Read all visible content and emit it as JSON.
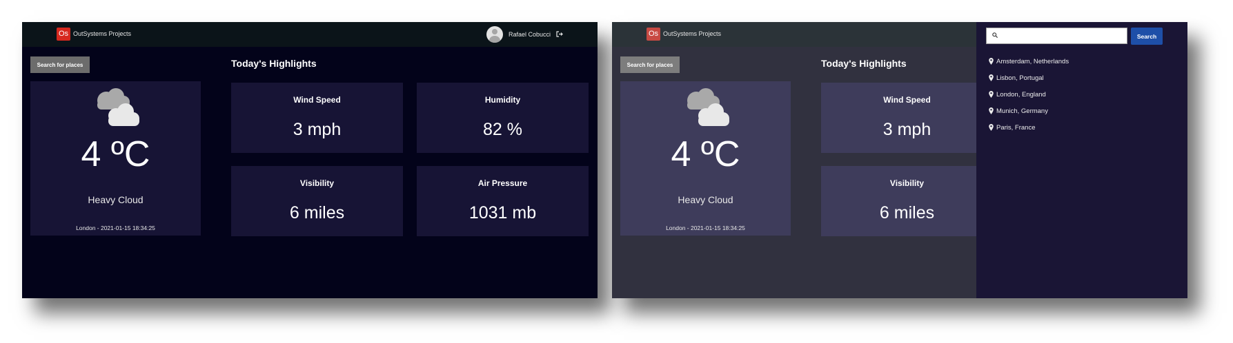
{
  "header": {
    "logo_text": "Os",
    "app_title": "OutSystems Projects",
    "user_name": "Rafael Cobucci"
  },
  "actions": {
    "search_places_label": "Search for places"
  },
  "current": {
    "temperature": "4 ºC",
    "condition": "Heavy Cloud",
    "location_datetime": "London - 2021-01-15 18:34:25",
    "icon": "heavy-cloud-icon"
  },
  "highlights": {
    "title": "Today's Highlights",
    "items": [
      {
        "label": "Wind Speed",
        "value": "3 mph"
      },
      {
        "label": "Humidity",
        "value": "82 %"
      },
      {
        "label": "Visibility",
        "value": "6 miles"
      },
      {
        "label": "Air Pressure",
        "value": "1031 mb"
      }
    ]
  },
  "search_panel": {
    "input_value": "",
    "button_label": "Search",
    "places": [
      "Amsterdam, Netherlands",
      "Lisbon, Portugal",
      "London, England",
      "Munich, Germany",
      "Paris, France"
    ]
  },
  "colors": {
    "logo_red": "#d7281e",
    "search_button_blue": "#1e4fa8",
    "dark_background": "#03031a",
    "card_background": "#171435"
  }
}
